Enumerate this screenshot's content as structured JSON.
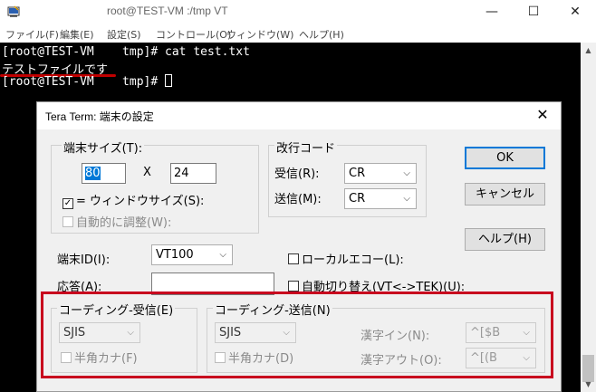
{
  "window": {
    "title": "root@TEST-VM     :/tmp VT",
    "minimize": "—",
    "maximize": "☐",
    "close": "✕"
  },
  "menu": [
    "ファイル(F)",
    "編集(E)",
    "設定(S)",
    "コントロール(O)",
    "ウィンドウ(W)",
    "ヘルプ(H)"
  ],
  "terminal": {
    "line1": "[root@TEST-VM    tmp]# cat test.txt",
    "line2": "テストファイルです",
    "line3": "[root@TEST-VM    tmp]# "
  },
  "dialog": {
    "title": "Tera Term: 端末の設定",
    "close": "✕",
    "terminal_size": {
      "label": "端末サイズ(T):",
      "cols": "80",
      "x": "X",
      "rows": "24",
      "window_size_label": "= ウィンドウサイズ(S):",
      "auto_adjust_label": "自動的に調整(W):"
    },
    "newline": {
      "label": "改行コード",
      "receive_label": "受信(R):",
      "receive_value": "CR",
      "send_label": "送信(M):",
      "send_value": "CR"
    },
    "terminal_id": {
      "label": "端末ID(I):",
      "value": "VT100"
    },
    "answerback": {
      "label": "応答(A):",
      "value": ""
    },
    "local_echo_label": "ローカルエコー(L):",
    "auto_switch_label": "自動切り替え(VT<->TEK)(U):",
    "buttons": {
      "ok": "OK",
      "cancel": "キャンセル",
      "help": "ヘルプ(H)"
    },
    "coding_receive": {
      "label": "コーディング-受信(E)",
      "value": "SJIS",
      "kana_label": "半角カナ(F)"
    },
    "coding_send": {
      "label": "コーディング-送信(N)",
      "value": "SJIS",
      "kana_label": "半角カナ(D)",
      "kanji_in_label": "漢字イン(N):",
      "kanji_in_value": "^[$B",
      "kanji_out_label": "漢字アウト(O):",
      "kanji_out_value": "^[(B"
    }
  },
  "colors": {
    "highlight": "#c8001e",
    "selection": "#0078d7",
    "terminal_bg": "#000000"
  }
}
